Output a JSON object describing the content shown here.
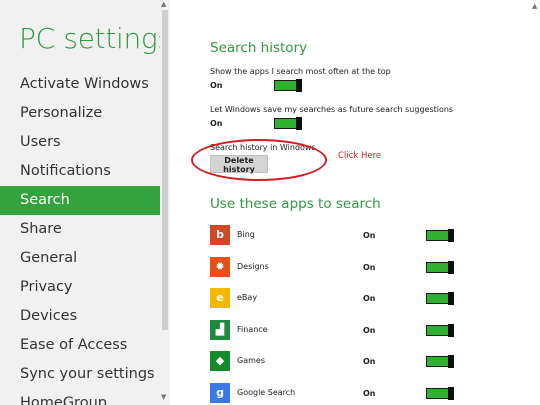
{
  "nav": {
    "title": "PC settings",
    "items": [
      {
        "label": "Activate Windows"
      },
      {
        "label": "Personalize"
      },
      {
        "label": "Users"
      },
      {
        "label": "Notifications"
      },
      {
        "label": "Search",
        "selected": true
      },
      {
        "label": "Share"
      },
      {
        "label": "General"
      },
      {
        "label": "Privacy"
      },
      {
        "label": "Devices"
      },
      {
        "label": "Ease of Access"
      },
      {
        "label": "Sync your settings"
      },
      {
        "label": "HomeGroup"
      }
    ]
  },
  "search_history": {
    "heading": "Search history",
    "show_apps": {
      "label": "Show the apps I search most often at the top",
      "state": "On"
    },
    "save_searches": {
      "label": "Let Windows save my searches as future search suggestions",
      "state": "On"
    },
    "history_label": "Search history in Windows",
    "delete_button": "Delete history"
  },
  "annotation": {
    "text": "Click Here"
  },
  "apps_section": {
    "heading": "Use these apps to search",
    "apps": [
      {
        "name": "Bing",
        "state": "On",
        "icon": "bing-icon",
        "color": "#d24726",
        "glyph": "b"
      },
      {
        "name": "Designs",
        "state": "On",
        "icon": "designs-icon",
        "color": "#e8501a",
        "glyph": "✹"
      },
      {
        "name": "eBay",
        "state": "On",
        "icon": "ebay-icon",
        "color": "#f5b800",
        "glyph": "e"
      },
      {
        "name": "Finance",
        "state": "On",
        "icon": "finance-icon",
        "color": "#1e8a3c",
        "glyph": "▟"
      },
      {
        "name": "Games",
        "state": "On",
        "icon": "games-icon",
        "color": "#128c2a",
        "glyph": "◆"
      },
      {
        "name": "Google Search",
        "state": "On",
        "icon": "google-search-icon",
        "color": "#3b78e7",
        "glyph": "g"
      }
    ]
  },
  "colors": {
    "accent": "#34a33e",
    "toggle_on": "#2fb12f",
    "annotation": "#d21e1e"
  }
}
